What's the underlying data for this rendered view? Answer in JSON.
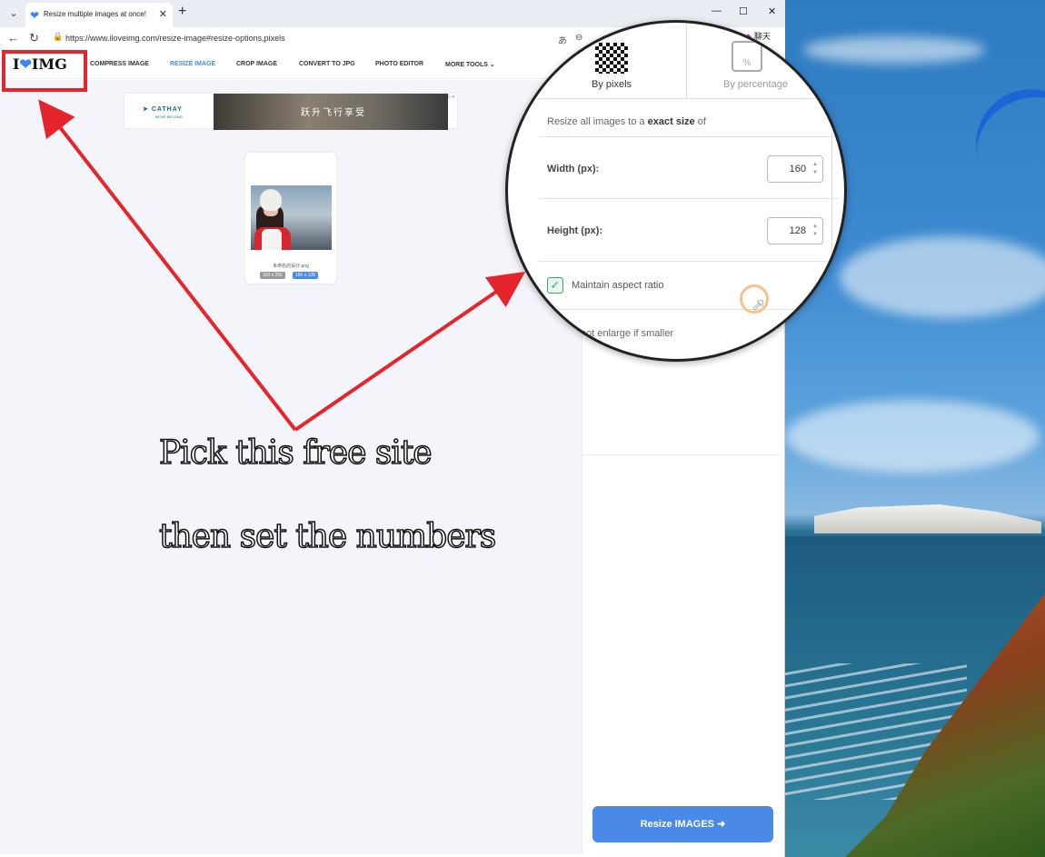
{
  "browser": {
    "tab_title": "Resize multiple images at once!",
    "url": "https://www.iloveimg.com/resize-image#resize-options,pixels",
    "chat_label": "聊天",
    "tab_menu_icon": "chevron-down-icon",
    "window_controls": [
      "minimize-icon",
      "maximize-icon",
      "close-icon"
    ]
  },
  "site": {
    "logo_left": "I",
    "logo_right": "IMG",
    "nav": [
      "COMPRESS IMAGE",
      "RESIZE IMAGE",
      "CROP IMAGE",
      "CONVERT TO JPG",
      "PHOTO EDITOR",
      "MORE TOOLS"
    ],
    "active_nav": "RESIZE IMAGE"
  },
  "ad": {
    "brand": "CATHAY",
    "brand_sub": "MOVE BEYOND",
    "headline": "跃升飞行享受"
  },
  "file": {
    "name": "未命名的设计.png",
    "original_size": "320 x 256",
    "new_size": "160 x 128"
  },
  "options": {
    "tab_pixels": "By pixels",
    "tab_percentage": "By percentage",
    "description_prefix": "Resize all images to a ",
    "description_bold": "exact size",
    "description_suffix": " of",
    "width_label": "Width (px):",
    "width_value": "160",
    "height_label": "Height (px):",
    "height_value": "128",
    "maintain_aspect_label": "Maintain aspect ratio",
    "maintain_aspect_checked": true,
    "no_enlarge_label": "not enlarge if smaller",
    "submit_label": "Resize IMAGES"
  },
  "annotation": {
    "line1": "Pick this free site",
    "line2": "then set the numbers",
    "color": "#e5252b"
  }
}
